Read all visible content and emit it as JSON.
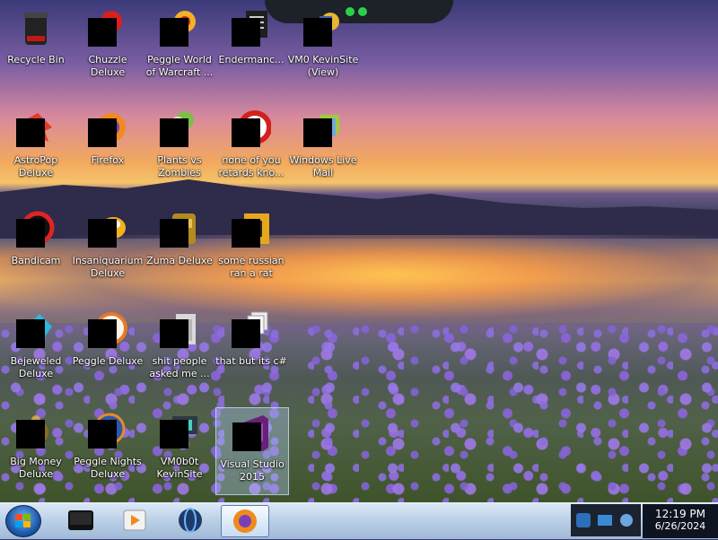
{
  "desktop": {
    "icons": [
      {
        "label": "Recycle Bin",
        "icon": "recycle-bin-icon"
      },
      {
        "label": "Chuzzle Deluxe",
        "icon": "chuzzle-icon"
      },
      {
        "label": "Peggle World of Warcraft ...",
        "icon": "peggle-wow-icon"
      },
      {
        "label": "Endermanc...",
        "icon": "document-icon"
      },
      {
        "label": "VM0 KevinSite (View)",
        "icon": "folder-shortcut-icon"
      },
      {
        "label": "AstroPop Deluxe",
        "icon": "astropop-icon"
      },
      {
        "label": "Firefox",
        "icon": "firefox-icon"
      },
      {
        "label": "Plants vs Zombies",
        "icon": "plants-vs-zombies-icon"
      },
      {
        "label": "none of you retards kno...",
        "icon": "bandicam-icon"
      },
      {
        "label": "Windows Live Mail",
        "icon": "windows-live-mail-icon"
      },
      {
        "label": "Bandicam",
        "icon": "bandicam-icon"
      },
      {
        "label": "Insaniquarium Deluxe",
        "icon": "insaniquarium-icon"
      },
      {
        "label": "Zuma Deluxe",
        "icon": "zuma-icon"
      },
      {
        "label": "some russian ran a rat",
        "icon": "adobe-bridge-icon"
      },
      {
        "label": "Bejeweled Deluxe",
        "icon": "bejeweled-icon"
      },
      {
        "label": "Peggle Deluxe",
        "icon": "peggle-icon"
      },
      {
        "label": "shit people asked me ...",
        "icon": "folder-icon"
      },
      {
        "label": "that but its c#",
        "icon": "document-stack-icon"
      },
      {
        "label": "Big Money Deluxe",
        "icon": "big-money-icon"
      },
      {
        "label": "Peggle Nights Deluxe",
        "icon": "peggle-nights-icon"
      },
      {
        "label": "VM0b0t KevinSite",
        "icon": "folder-shortcut-icon"
      },
      {
        "label": "Visual Studio 2015",
        "icon": "visual-studio-icon"
      }
    ],
    "selected_label": "Visual Studio 2015"
  },
  "taskbar": {
    "start_label": "Start",
    "pinned": [
      {
        "name": "tablet-icon"
      },
      {
        "name": "media-player-icon"
      },
      {
        "name": "globe-icon"
      },
      {
        "name": "firefox-icon"
      }
    ],
    "tray_icons": [
      "network-icon",
      "display-icon",
      "volume-icon"
    ],
    "clock_time": "12:19 PM",
    "clock_date": "6/26/2024"
  },
  "colors": {
    "taskbar": "#b9cfe6",
    "start_orb": "#1f5aa8",
    "notch_led": "#2ad04a"
  }
}
